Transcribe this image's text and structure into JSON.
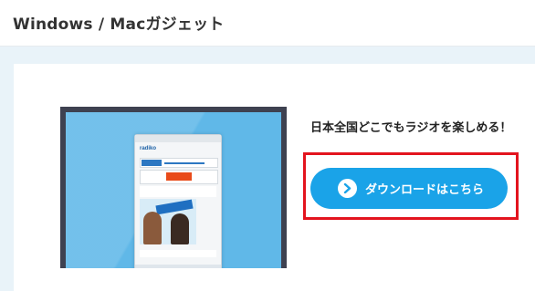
{
  "header": {
    "title": "Windows / Macガジェット"
  },
  "promo": {
    "tagline": "日本全国どこでもラジオを楽しめる！",
    "download_button": {
      "label": "ダウンロードはこちら",
      "icon": "chevron-right-icon"
    }
  },
  "colors": {
    "page_bg": "#e9f3f9",
    "button": "#1aa3e8",
    "highlight_border": "#e3141e",
    "screen_bg": "#60b8e8"
  }
}
